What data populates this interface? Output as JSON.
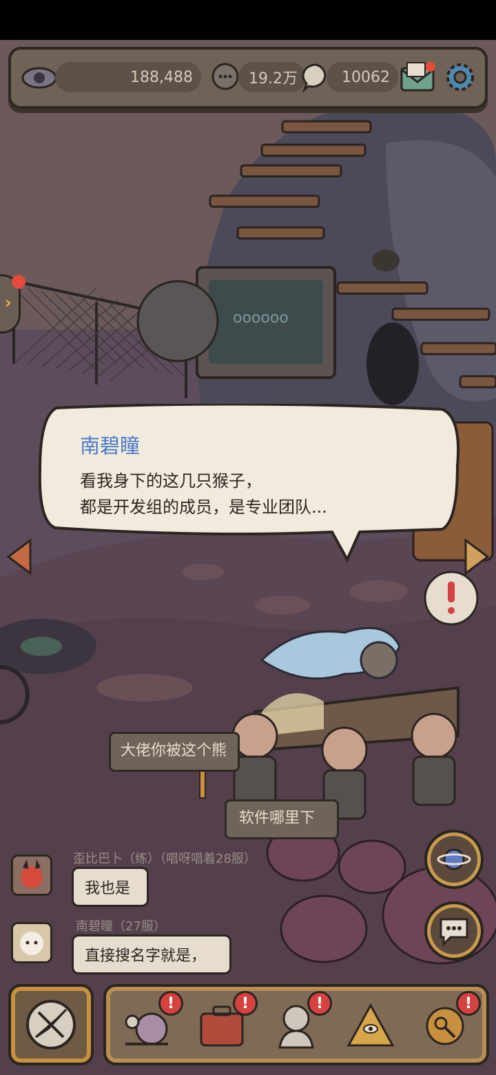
{
  "resources": {
    "views": "188,488",
    "comments": "19.2万",
    "messages": "10062"
  },
  "dialog": {
    "speaker": "南碧瞳",
    "line1": "看我身下的这几只猴子，",
    "line2": "都是开发组的成员，是专业团队..."
  },
  "floating_messages": [
    {
      "text": "大佬你被这个熊"
    },
    {
      "text": "软件哪里下"
    }
  ],
  "chat": [
    {
      "meta": "歪比巴卜（练）（唱呀唱着28服）",
      "text": "我也是"
    },
    {
      "meta": "南碧瞳（27服）",
      "text": "直接搜名字就是，"
    }
  ],
  "icons": {
    "views": "eye-icon",
    "comments": "speech-bubble-icon",
    "messages": "chat-bubble-icon",
    "mail": "mail-icon",
    "settings": "gear-icon",
    "planet": "planet-icon",
    "chat_button": "chat-icon",
    "main": "compass-icon",
    "bottom": [
      "snail-icon",
      "suitcase-icon",
      "bust-icon",
      "pyramid-eye-icon",
      "key-icon"
    ]
  },
  "colors": {
    "speaker_name": "#4b79c8",
    "badge": "#d64242",
    "bar_trim": "#c7913f"
  }
}
